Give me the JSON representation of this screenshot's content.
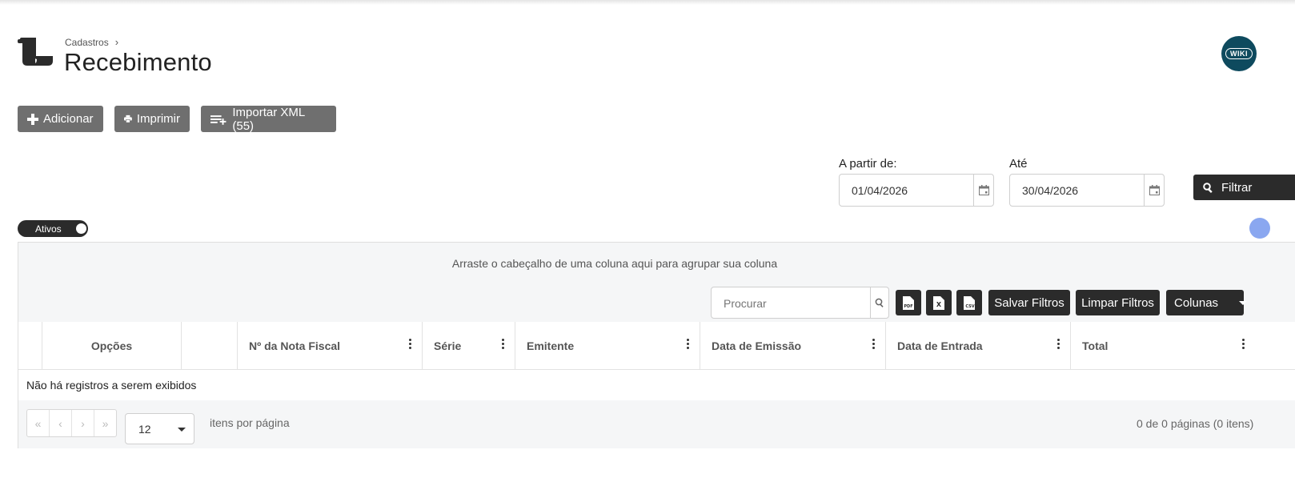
{
  "header": {
    "breadcrumb": "Cadastros",
    "title": "Recebimento",
    "wiki_label": "WIKI"
  },
  "actions": {
    "add_label": "Adicionar",
    "print_label": "Imprimir",
    "import_label": "Importar XML (55)"
  },
  "filters": {
    "from_label": "A partir de:",
    "from_value": "01/04/2026",
    "to_label": "Até",
    "to_value": "30/04/2026",
    "filter_label": "Filtrar"
  },
  "toggle": {
    "label": "Ativos",
    "on": true
  },
  "grid": {
    "group_hint": "Arraste o cabeçalho de uma coluna aqui para agrupar sua coluna",
    "search_placeholder": "Procurar",
    "toolbar": {
      "pdf_icon": "pdf-export-icon",
      "excel_icon": "excel-export-icon",
      "csv_icon": "csv-export-icon",
      "save_filters": "Salvar Filtros",
      "clear_filters": "Limpar Filtros",
      "columns": "Colunas"
    },
    "columns": [
      "Opções",
      "",
      "Nº da Nota Fiscal",
      "Série",
      "Emitente",
      "Data de Emissão",
      "Data de Entrada",
      "Total"
    ],
    "empty_message": "Não há registros a serem exibidos",
    "pager": {
      "first": "«",
      "prev": "‹",
      "next": "›",
      "last": "»",
      "page_size": "12",
      "page_size_label": "itens por página",
      "status": "0 de 0 páginas (0 itens)"
    }
  }
}
